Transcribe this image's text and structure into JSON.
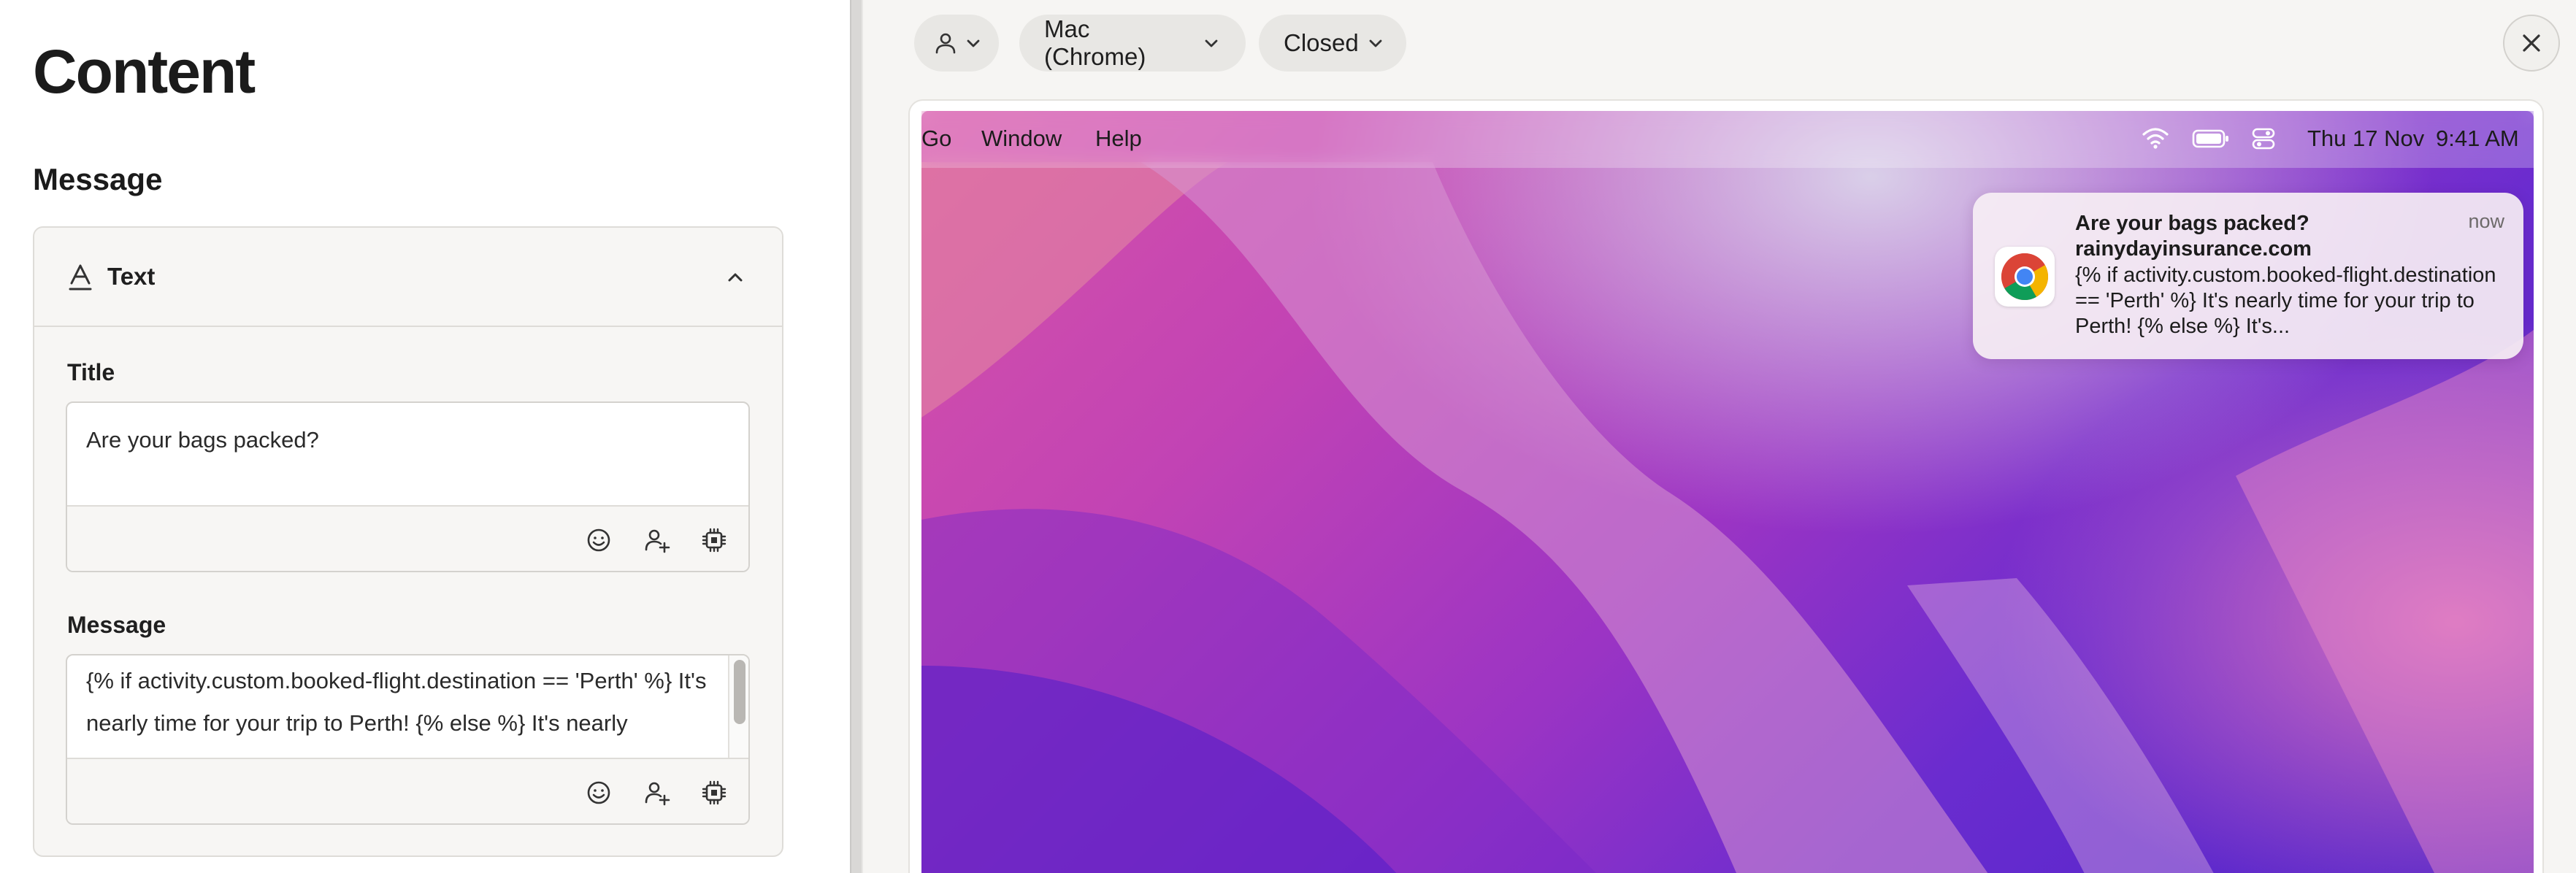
{
  "left": {
    "page_title": "Content",
    "section_title": "Message",
    "card": {
      "header_label": "Text",
      "fields": {
        "title": {
          "label": "Title",
          "value": "Are your bags packed?"
        },
        "message": {
          "label": "Message",
          "value": "{% if activity.custom.booked-flight.destination == 'Perth' %} It's nearly time for your trip to Perth! {% else %} It's nearly"
        }
      }
    }
  },
  "right": {
    "toolbar": {
      "platform": "Mac (Chrome)",
      "state": "Closed"
    },
    "menubar": {
      "items": [
        "Go",
        "Window",
        "Help"
      ],
      "date": "Thu 17 Nov",
      "time": "9:41 AM"
    },
    "notification": {
      "title": "Are your bags packed?",
      "site": "rainydayinsurance.com",
      "body": "{% if activity.custom.booked-flight.destination == 'Perth' %} It's nearly time for your trip to Perth! {% else %} It's...",
      "time": "now"
    }
  }
}
